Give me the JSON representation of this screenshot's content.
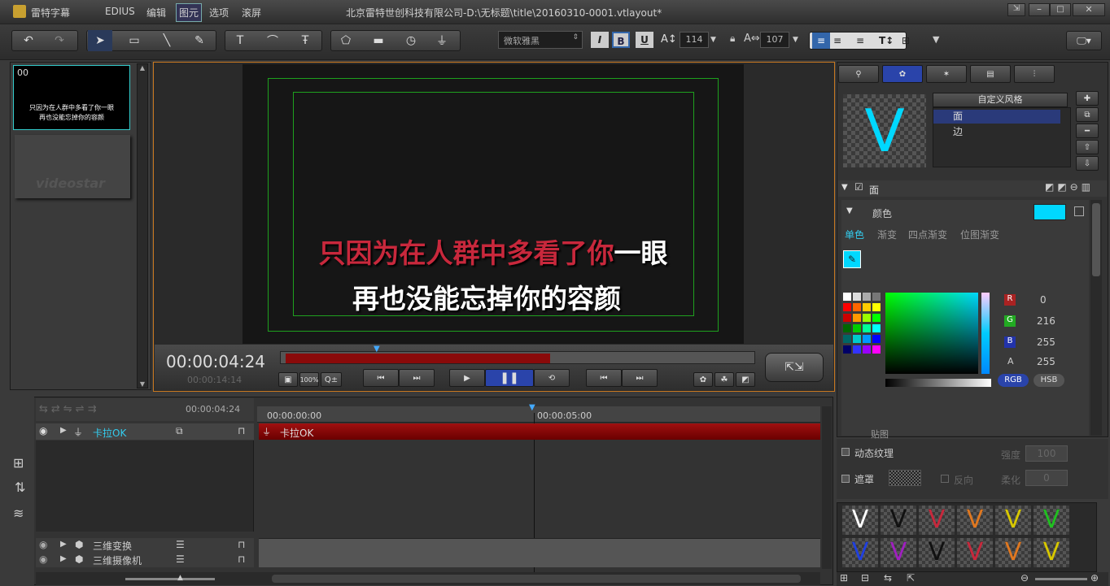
{
  "titlebar": {
    "app_name": "雷特字幕",
    "menus": [
      "EDIUS",
      "编辑",
      "图元",
      "选项",
      "滚屏"
    ],
    "file_path": "北京雷特世创科技有限公司-D:\\无标题\\title\\20160310-0001.vtlayout*"
  },
  "toolbar": {
    "font_name": "微软雅黑",
    "bold": "B",
    "italic": "I",
    "underline": "U",
    "font_size": "114",
    "spacing": "107"
  },
  "pages": [
    {
      "number": "00",
      "line1": "只因为在人群中多看了你一眼",
      "line2": "再也没能忘掉你的容颜"
    },
    {
      "number": "",
      "watermark": "videostar"
    }
  ],
  "canvas": {
    "line1_highlight": "只因为在人群中多看了你",
    "line1_rest": "一眼",
    "line2": "再也没能忘掉你的容颜",
    "highlight_color": "#c8283c"
  },
  "player": {
    "timecode": "00:00:04:24",
    "timecode_total": "00:00:14:14",
    "zoom": "100%",
    "progress": 0.57
  },
  "timeline": {
    "current": "00:00:04:24",
    "ruler": [
      "00:00:00:00",
      "00:00:05:00"
    ],
    "track_name": "卡拉OK",
    "clip_label": "卡拉OK",
    "lower_tracks": [
      "三维变换",
      "三维摄像机"
    ]
  },
  "style_panel": {
    "style_select": "自定义风格",
    "items": [
      "面",
      "边"
    ],
    "section_face": "面",
    "color_label": "颜色",
    "fill_tabs": [
      "单色",
      "渐变",
      "四点渐变",
      "位图渐变"
    ],
    "swatch_color": "#00d8ff",
    "rgb": {
      "R": "0",
      "G": "216",
      "B": "255",
      "A": "255"
    },
    "rgb_btn": "RGB",
    "hsb_btn": "HSB",
    "texture_label": "贴图",
    "dynamic_texture": "动态纹理",
    "intensity_label": "强度",
    "intensity_value": "100",
    "mask_label": "遮罩",
    "invert_label": "反向",
    "soften_label": "柔化",
    "soften_value": "0"
  },
  "presets": {
    "row1": [
      "#ffffff",
      "#111111",
      "#c8283c",
      "#e07820",
      "#d8c800",
      "#20c020"
    ],
    "row2": [
      "#2040e0",
      "#a020c0",
      "#111111",
      "#c8283c",
      "#e07820",
      "#d8c800"
    ]
  },
  "preview_letter": "V"
}
